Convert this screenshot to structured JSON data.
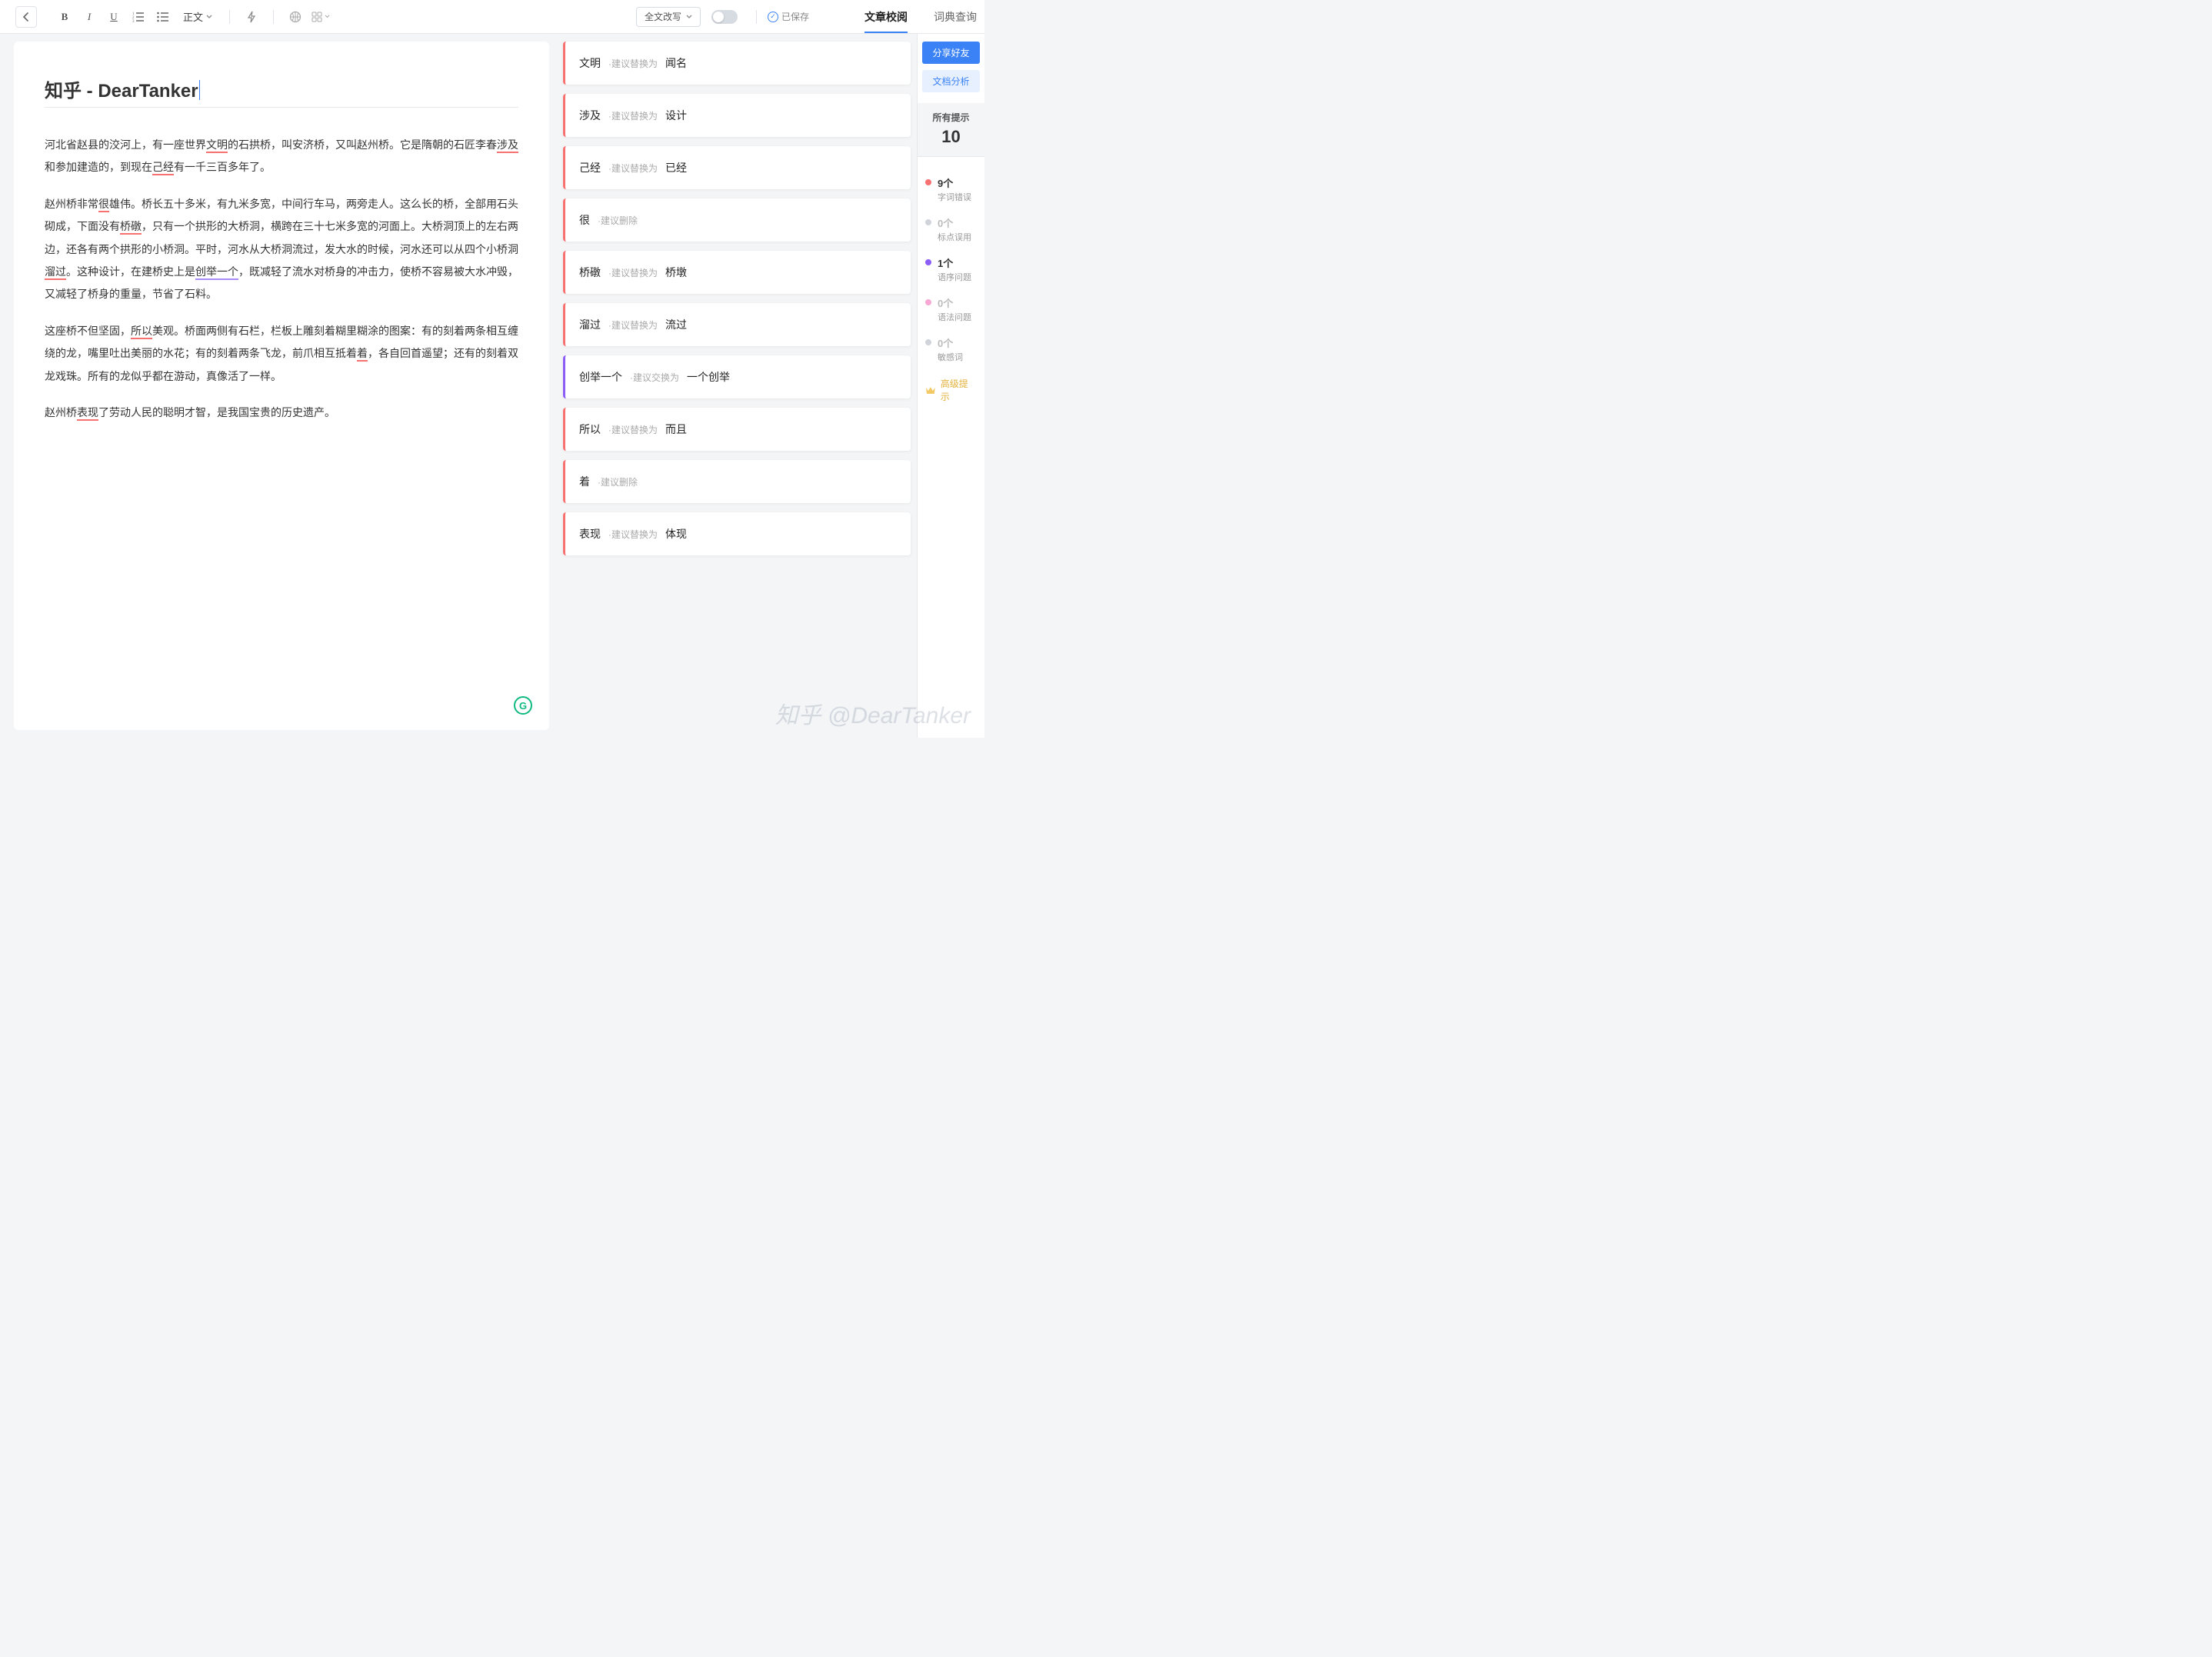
{
  "toolbar": {
    "style_label": "正文",
    "rewrite_label": "全文改写",
    "saved_label": "已保存"
  },
  "tabs": {
    "proofread": "文章校阅",
    "dictionary": "词典查询"
  },
  "document": {
    "title": "知乎 - DearTanker",
    "p1_a": "河北省赵县的洨河上，有一座世界",
    "p1_e1": "文明",
    "p1_b": "的石拱桥，叫安济桥，又叫赵州桥。它是隋朝的石匠李春",
    "p1_e2": "涉及",
    "p1_c": "和参加建造的，到现在",
    "p1_e3": "己经",
    "p1_d": "有一千三百多年了。",
    "p2_a": "赵州桥非常",
    "p2_e1": "很",
    "p2_b": "雄伟。桥长五十多米，有九米多宽，中间行车马，两旁走人。这么长的桥，全部用石头砌成，下面没有",
    "p2_e2": "桥礅",
    "p2_c": "，只有一个拱形的大桥洞，横跨在三十七米多宽的河面上。大桥洞顶上的左右两边，还各有两个拱形的小桥洞。平时，河水从大桥洞流过，发大水的时候，河水还可以从四个小桥洞",
    "p2_e3": "溜过",
    "p2_d": "。这种设计，在建桥史上是",
    "p2_e4": "创举一个",
    "p2_e": "，既减轻了流水对桥身的冲击力，使桥不容易被大水冲毁，又减轻了桥身的重量，节省了石料。",
    "p3_a": "这座桥不但坚固，",
    "p3_e1": "所以",
    "p3_b": "美观。桥面两侧有石栏，栏板上雕刻着糊里糊涂的图案：有的刻着两条相互缠绕的龙，嘴里吐出美丽的水花；有的刻着两条飞龙，前爪相互抵着",
    "p3_e2": "着",
    "p3_c": "，各自回首遥望；还有的刻着双龙戏珠。所有的龙似乎都在游动，真像活了一样。",
    "p4_a": "赵州桥",
    "p4_e1": "表现",
    "p4_b": "了劳动人民的聪明才智，是我国宝贵的历史遗产。"
  },
  "suggestions": [
    {
      "word": "文明",
      "hint": "·建议替换为",
      "replacement": "闻名",
      "accent": "red"
    },
    {
      "word": "涉及",
      "hint": "·建议替换为",
      "replacement": "设计",
      "accent": "red"
    },
    {
      "word": "己经",
      "hint": "·建议替换为",
      "replacement": "已经",
      "accent": "red"
    },
    {
      "word": "很",
      "hint": "·建议删除",
      "replacement": "",
      "accent": "red"
    },
    {
      "word": "桥礅",
      "hint": "·建议替换为",
      "replacement": "桥墩",
      "accent": "red"
    },
    {
      "word": "溜过",
      "hint": "·建议替换为",
      "replacement": "流过",
      "accent": "red"
    },
    {
      "word": "创举一个",
      "hint": "·建议交换为",
      "replacement": "一个创举",
      "accent": "purple"
    },
    {
      "word": "所以",
      "hint": "·建议替换为",
      "replacement": "而且",
      "accent": "red"
    },
    {
      "word": "着",
      "hint": "·建议删除",
      "replacement": "",
      "accent": "red"
    },
    {
      "word": "表现",
      "hint": "·建议替换为",
      "replacement": "体现",
      "accent": "red"
    }
  ],
  "sidebar": {
    "share_label": "分享好友",
    "analyze_label": "文档分析",
    "total_label": "所有提示",
    "total_count": "10",
    "stats": [
      {
        "count": "9个",
        "label": "字词错误",
        "color": "red",
        "dim": false
      },
      {
        "count": "0个",
        "label": "标点误用",
        "color": "gray",
        "dim": true
      },
      {
        "count": "1个",
        "label": "语序问题",
        "color": "purple",
        "dim": false
      },
      {
        "count": "0个",
        "label": "语法问题",
        "color": "pink",
        "dim": true
      },
      {
        "count": "0个",
        "label": "敏感词",
        "color": "gray",
        "dim": true
      }
    ],
    "premium_label": "高级提示"
  },
  "watermark": "知乎 @DearTanker"
}
